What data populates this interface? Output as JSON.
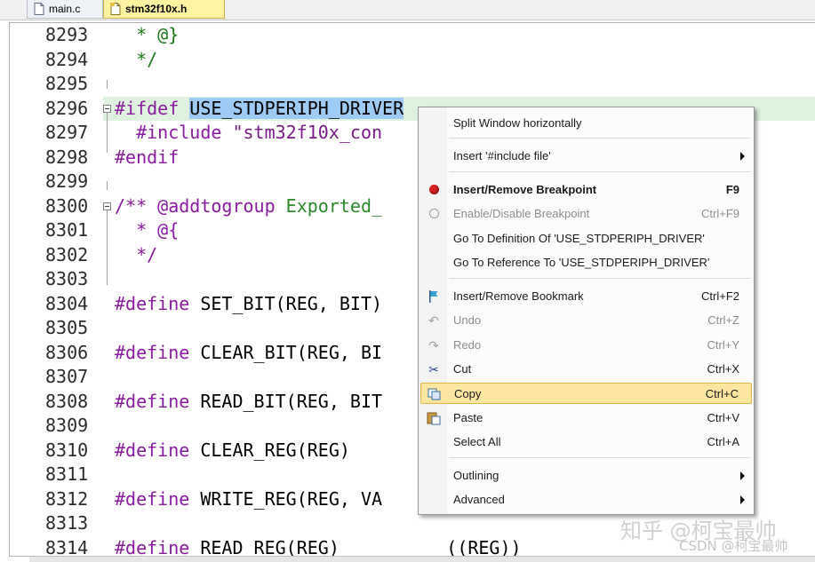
{
  "tabs": [
    {
      "label": "main.c"
    },
    {
      "label": "stm32f10x.h",
      "active": true
    }
  ],
  "editor": {
    "lines": [
      {
        "n": "8293",
        "code": "  * @}"
      },
      {
        "n": "8294",
        "code": "  */"
      },
      {
        "n": "8295",
        "code": ""
      },
      {
        "n": "8296",
        "pre": "#ifdef ",
        "sel": "USE_STDPERIPH_DRIVER"
      },
      {
        "n": "8297",
        "pre": "  #include ",
        "str": "\"stm32f10x_con"
      },
      {
        "n": "8298",
        "code": "#endif"
      },
      {
        "n": "8299",
        "code": ""
      },
      {
        "n": "8300",
        "cm": "/** @addtogroup ",
        "grn": "Exported_"
      },
      {
        "n": "8301",
        "code": "  * @{"
      },
      {
        "n": "8302",
        "code": "  */"
      },
      {
        "n": "8303",
        "code": ""
      },
      {
        "n": "8304",
        "pre": "#define ",
        "rest": "SET_BIT(REG, BIT)"
      },
      {
        "n": "8305",
        "code": ""
      },
      {
        "n": "8306",
        "pre": "#define ",
        "rest": "CLEAR_BIT(REG, BI"
      },
      {
        "n": "8307",
        "code": ""
      },
      {
        "n": "8308",
        "pre": "#define ",
        "rest": "READ_BIT(REG, BIT"
      },
      {
        "n": "8309",
        "code": ""
      },
      {
        "n": "8310",
        "pre": "#define ",
        "rest": "CLEAR_REG(REG)"
      },
      {
        "n": "8311",
        "code": ""
      },
      {
        "n": "8312",
        "pre": "#define ",
        "rest": "WRITE_REG(REG, VA"
      },
      {
        "n": "8313",
        "code": ""
      },
      {
        "n": "8314",
        "pre": "#define ",
        "rest": "READ_REG(REG)          ((REG))"
      }
    ]
  },
  "context_menu": {
    "items": [
      {
        "label": "Split Window horizontally"
      },
      {
        "label": "Insert '#include file'",
        "submenu": true
      },
      {
        "label": "Insert/Remove Breakpoint",
        "shortcut": "F9",
        "icon": "breakpoint-icon",
        "bold": true
      },
      {
        "label": "Enable/Disable Breakpoint",
        "shortcut": "Ctrl+F9",
        "icon": "breakpoint-outline-icon",
        "disabled": true
      },
      {
        "label": "Go To Definition Of 'USE_STDPERIPH_DRIVER'"
      },
      {
        "label": "Go To Reference To 'USE_STDPERIPH_DRIVER'"
      },
      {
        "label": "Insert/Remove Bookmark",
        "shortcut": "Ctrl+F2",
        "icon": "bookmark-flag-icon"
      },
      {
        "label": "Undo",
        "shortcut": "Ctrl+Z",
        "icon": "undo-icon",
        "disabled": true
      },
      {
        "label": "Redo",
        "shortcut": "Ctrl+Y",
        "icon": "redo-icon",
        "disabled": true
      },
      {
        "label": "Cut",
        "shortcut": "Ctrl+X",
        "icon": "scissors-icon"
      },
      {
        "label": "Copy",
        "shortcut": "Ctrl+C",
        "icon": "copy-icon",
        "selected": true
      },
      {
        "label": "Paste",
        "shortcut": "Ctrl+V",
        "icon": "paste-icon"
      },
      {
        "label": "Select All",
        "shortcut": "Ctrl+A"
      },
      {
        "label": "Outlining",
        "submenu": true
      },
      {
        "label": "Advanced",
        "submenu": true
      }
    ]
  },
  "watermark": {
    "main": "知乎 @柯宝最帅",
    "sub": "CSDN @柯宝最帅"
  },
  "colors": {
    "selection": "#9ecbf5",
    "menu_highlight": "#fde7a0",
    "preprocessor": "#8a1aa0",
    "comment_green": "#2a8a2a",
    "active_tab": "#fdf3a0"
  }
}
